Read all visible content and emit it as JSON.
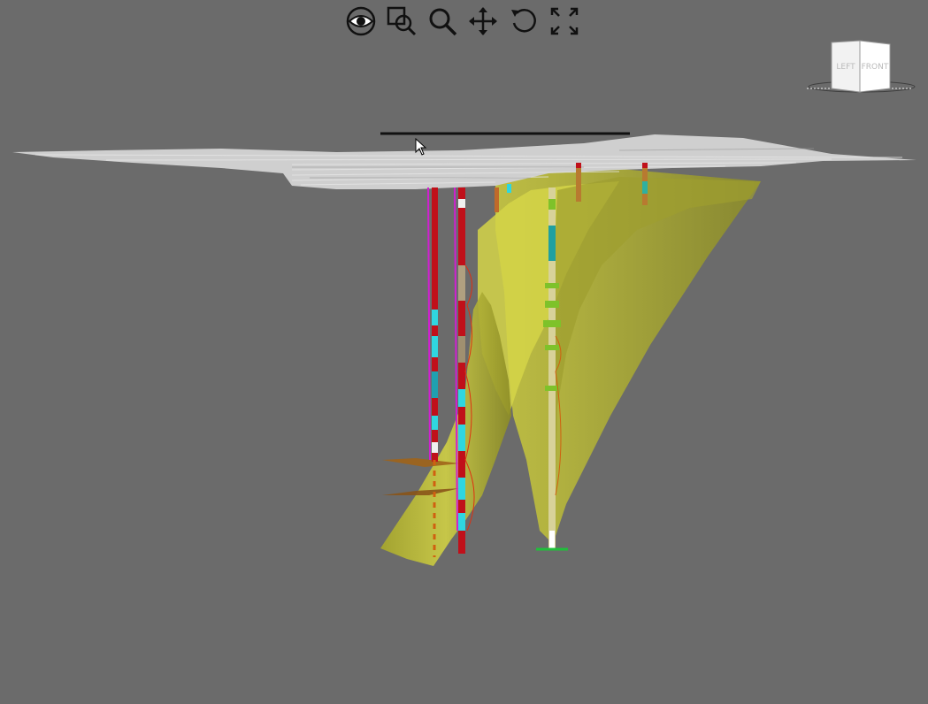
{
  "toolbar": {
    "tools": [
      {
        "icon": "eye-icon",
        "name": "view"
      },
      {
        "icon": "zoom-box-icon",
        "name": "zoom-box"
      },
      {
        "icon": "magnifier-icon",
        "name": "zoom"
      },
      {
        "icon": "move-arrows-icon",
        "name": "pan"
      },
      {
        "icon": "rotate-icon",
        "name": "rotate"
      },
      {
        "icon": "expand-icon",
        "name": "fit-extent"
      }
    ]
  },
  "viewcube": {
    "left_face": "LEFT",
    "right_face": "FRONT"
  },
  "colors": {
    "background": "#6b6b6b",
    "surface": "#bdbd3a",
    "terrain": "#cfcfcf",
    "drillhole_red": "#c0101a",
    "drillhole_cyan": "#2fd6e0",
    "drillhole_magenta": "#d020d0",
    "drillhole_green": "#7ec22a"
  }
}
